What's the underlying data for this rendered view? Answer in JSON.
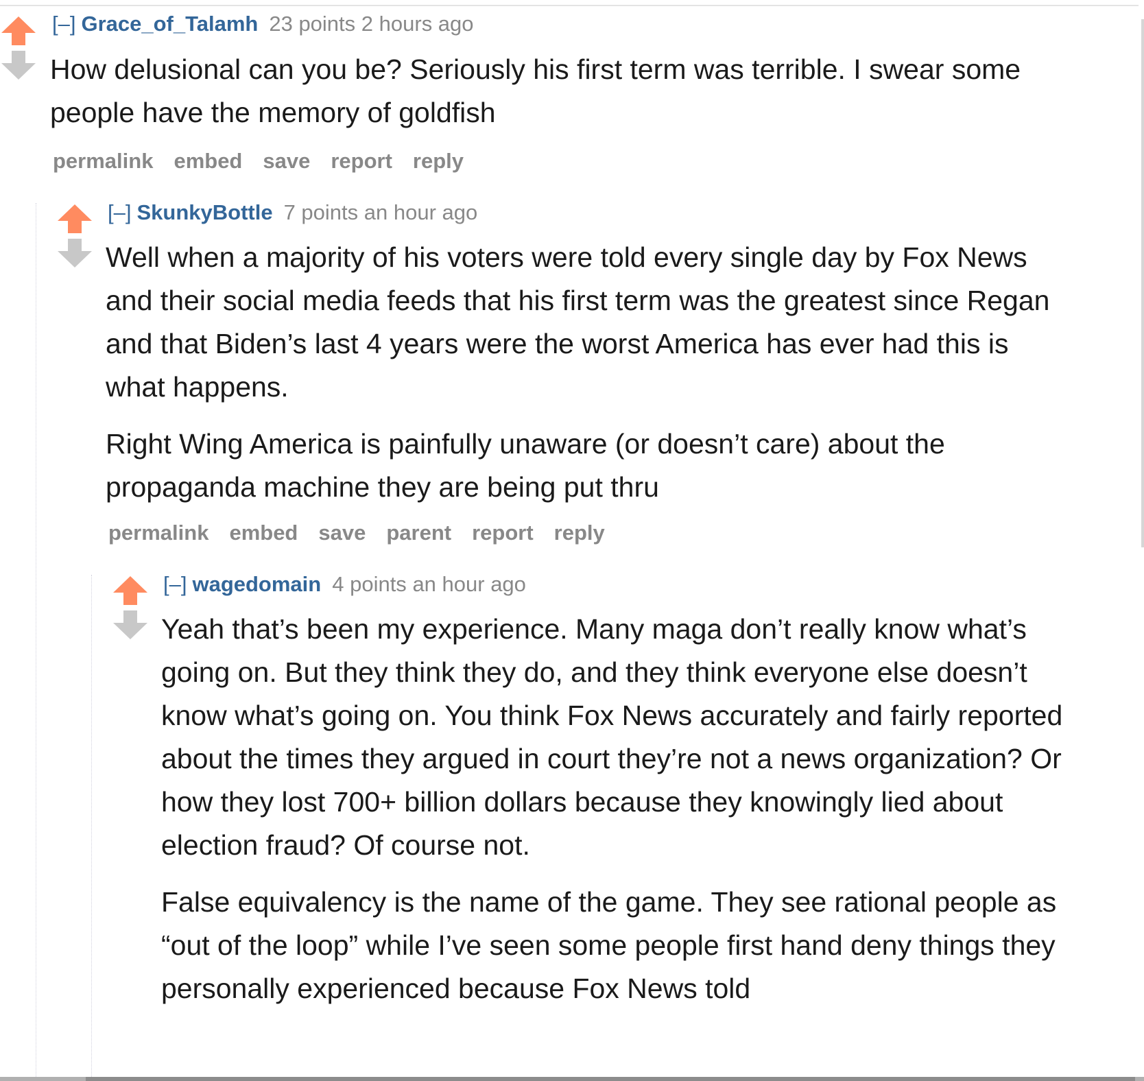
{
  "colors": {
    "upvote": "#ff8b60",
    "downvote": "#c8c8c8",
    "author": "#336699",
    "meta": "#888888",
    "text": "#1a1a1a"
  },
  "comments": [
    {
      "collapse": "[–]",
      "author": "Grace_of_Talamh",
      "score": "23 points",
      "time": "2 hours ago",
      "paragraphs": [
        "How delusional can you be? Seriously his first term was terrible. I swear some people have the memory of goldfish"
      ],
      "buttons": [
        "permalink",
        "embed",
        "save",
        "report",
        "reply"
      ]
    },
    {
      "collapse": "[–]",
      "author": "SkunkyBottle",
      "score": "7 points",
      "time": "an hour ago",
      "paragraphs": [
        "Well when a majority of his voters were told every single day by Fox News and their social media feeds that his first term was the greatest since Regan and that Biden’s last 4 years were the worst America has ever had this is what happens.",
        "Right Wing America is painfully unaware (or doesn’t care) about the propaganda machine they are being put thru"
      ],
      "buttons": [
        "permalink",
        "embed",
        "save",
        "parent",
        "report",
        "reply"
      ]
    },
    {
      "collapse": "[–]",
      "author": "wagedomain",
      "score": "4 points",
      "time": "an hour ago",
      "paragraphs": [
        "Yeah that’s been my experience. Many maga don’t really know what’s going on. But they think they do, and they think everyone else doesn’t know what’s going on. You think Fox News accurately and fairly reported about the times they argued in court they’re not a news organization? Or how they lost 700+ billion dollars because they knowingly lied about election fraud? Of course not.",
        "False equivalency is the name of the game. They see rational people as “out of the loop” while I’ve seen some people first hand deny things they personally experienced because Fox News told"
      ],
      "buttons": []
    }
  ]
}
